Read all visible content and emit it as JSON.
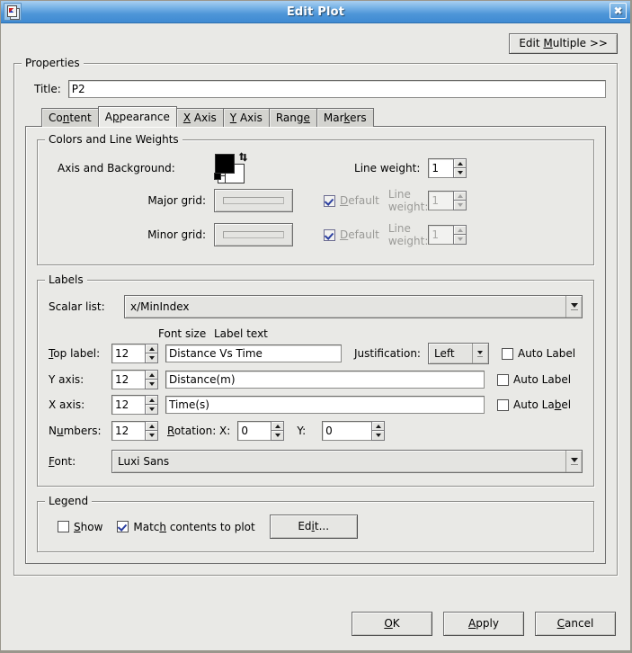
{
  "window": {
    "title": "Edit Plot",
    "icon": "plot-document-icon",
    "close_label": "✖"
  },
  "toolbar": {
    "edit_multiple": {
      "pre": "Edit ",
      "mnemonic": "M",
      "post": "ultiple >>"
    }
  },
  "properties": {
    "legend": "Properties",
    "title_label": "Title:",
    "title_value": "P2",
    "title_placeholder": ""
  },
  "tabs": [
    {
      "pre": "Co",
      "mnemonic": "n",
      "post": "tent",
      "selected": false
    },
    {
      "pre": "A",
      "mnemonic": "p",
      "post": "pearance",
      "selected": true
    },
    {
      "pre": "",
      "mnemonic": "X",
      "post": " Axis",
      "selected": false
    },
    {
      "pre": "",
      "mnemonic": "Y",
      "post": " Axis",
      "selected": false
    },
    {
      "pre": "Rang",
      "mnemonic": "e",
      "post": "",
      "selected": false
    },
    {
      "pre": "Mar",
      "mnemonic": "k",
      "post": "ers",
      "selected": false
    }
  ],
  "colors": {
    "legend": "Colors and Line Weights",
    "axis_background_label": "Axis and Background:",
    "foreground_color": "#000000",
    "background_color": "#ffffff",
    "swap_icon": "swap-colors-icon",
    "reset_icon": "reset-colors-icon",
    "major_grid_label": "Major grid:",
    "minor_grid_label": "Minor grid:",
    "default_label": {
      "pre": "",
      "mnemonic": "D",
      "post": "efault"
    },
    "major_grid_default_checked": true,
    "minor_grid_default_checked": true,
    "line_weight_label": "Line weight:",
    "line_weight_value": "1",
    "major_grid_line_weight": "1",
    "minor_grid_line_weight": "1"
  },
  "labels": {
    "legend": "Labels",
    "scalar_list_label": "Scalar list:",
    "scalar_list_value": "x/MinIndex",
    "col_font_size": "Font size",
    "col_label_text": "Label text",
    "auto_label": "Auto Label",
    "rows": [
      {
        "name": "top-label",
        "label": {
          "pre": "",
          "mnemonic": "T",
          "post": "op label:"
        },
        "font_size": "12",
        "text": "Distance Vs Time",
        "auto_checked": false,
        "auto_mnemonic": "L"
      },
      {
        "name": "y-axis-label",
        "label": {
          "pre": "Y axis:",
          "mnemonic": "",
          "post": ""
        },
        "font_size": "12",
        "text": "Distance(m)",
        "auto_checked": false,
        "auto_mnemonic": ""
      },
      {
        "name": "x-axis-label",
        "label": {
          "pre": "X axis:",
          "mnemonic": "",
          "post": ""
        },
        "font_size": "12",
        "text": "Time(s)",
        "auto_checked": false,
        "auto_mnemonic": "b"
      }
    ],
    "justification_label": "Justification:",
    "justification_value": "Left",
    "numbers_label": {
      "pre": "N",
      "mnemonic": "u",
      "post": "mbers:"
    },
    "numbers_font_size": "12",
    "rotation_label": {
      "pre": "",
      "mnemonic": "R",
      "post": "otation: X:"
    },
    "rotation_x": "0",
    "rotation_y_label": "Y:",
    "rotation_y": "0",
    "font_label": {
      "pre": "",
      "mnemonic": "F",
      "post": "ont:"
    },
    "font_value": "Luxi Sans"
  },
  "legend_section": {
    "legend": "Legend",
    "show": {
      "pre": "",
      "mnemonic": "S",
      "post": "how"
    },
    "show_checked": false,
    "match": {
      "pre": "Matc",
      "mnemonic": "h",
      "post": " contents to plot"
    },
    "match_checked": true,
    "edit_button": {
      "pre": "Ed",
      "mnemonic": "i",
      "post": "t..."
    }
  },
  "buttons": {
    "ok": {
      "pre": "",
      "mnemonic": "O",
      "post": "K"
    },
    "apply": {
      "pre": "",
      "mnemonic": "A",
      "post": "pply"
    },
    "cancel": {
      "pre": "",
      "mnemonic": "C",
      "post": "ancel"
    }
  }
}
